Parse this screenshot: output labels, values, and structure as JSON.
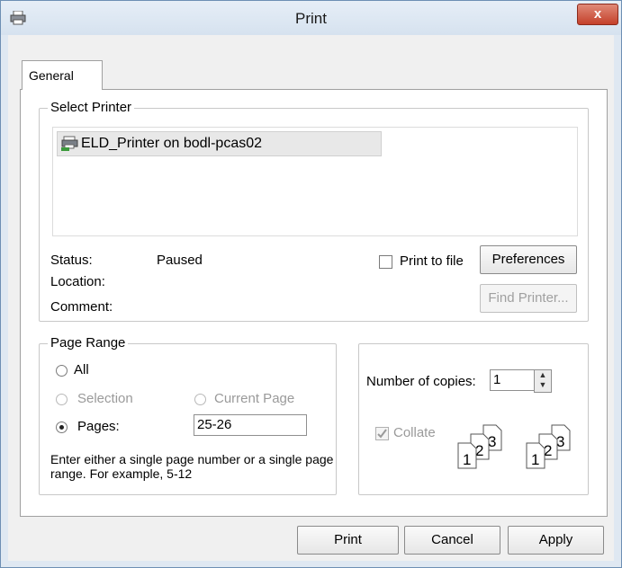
{
  "window": {
    "title": "Print",
    "close_label": "x"
  },
  "tabs": [
    {
      "label": "General"
    }
  ],
  "select_printer": {
    "group_label": "Select Printer",
    "printers": [
      {
        "name": "ELD_Printer on bodl-pcas02"
      }
    ],
    "status_label": "Status:",
    "status_value": "Paused",
    "location_label": "Location:",
    "comment_label": "Comment:",
    "print_to_file_label": "Print to file",
    "preferences_button": "Preferences",
    "find_printer_button": "Find Printer..."
  },
  "page_range": {
    "group_label": "Page Range",
    "all_label": "All",
    "selection_label": "Selection",
    "current_page_label": "Current Page",
    "pages_label": "Pages:",
    "pages_value": "25-26",
    "hint": "Enter either a single page number or a single page range.  For example, 5-12"
  },
  "copies": {
    "number_label": "Number of copies:",
    "number_value": "1",
    "collate_label": "Collate",
    "collate_checked": true
  },
  "footer": {
    "print_button": "Print",
    "cancel_button": "Cancel",
    "apply_button": "Apply"
  }
}
